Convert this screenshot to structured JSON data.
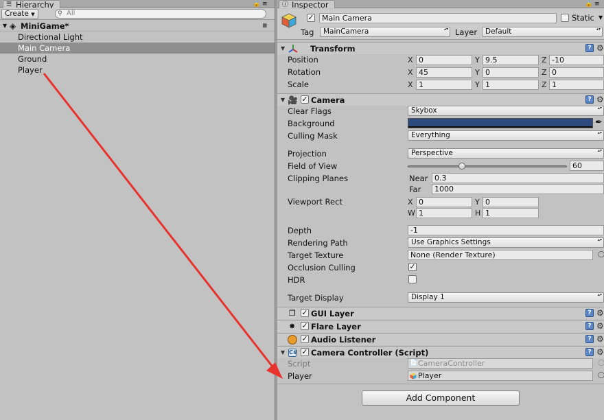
{
  "hierarchy": {
    "tab": "Hierarchy",
    "create_label": "Create",
    "search_placeholder": "All",
    "scene_name": "MiniGame*",
    "items": [
      "Directional Light",
      "Main Camera",
      "Ground",
      "Player"
    ],
    "selected_index": 1
  },
  "inspector": {
    "tab": "Inspector",
    "object_name": "Main Camera",
    "static_label": "Static",
    "tag_label": "Tag",
    "tag_value": "MainCamera",
    "layer_label": "Layer",
    "layer_value": "Default"
  },
  "transform": {
    "title": "Transform",
    "position_label": "Position",
    "rotation_label": "Rotation",
    "scale_label": "Scale",
    "axes": [
      "X",
      "Y",
      "Z"
    ],
    "position": [
      "0",
      "9.5",
      "-10"
    ],
    "rotation": [
      "45",
      "0",
      "0"
    ],
    "scale": [
      "1",
      "1",
      "1"
    ]
  },
  "camera": {
    "title": "Camera",
    "clear_flags_label": "Clear Flags",
    "clear_flags": "Skybox",
    "background_label": "Background",
    "background_color": "#2c4a7c",
    "culling_mask_label": "Culling Mask",
    "culling_mask": "Everything",
    "projection_label": "Projection",
    "projection": "Perspective",
    "fov_label": "Field of View",
    "fov": "60",
    "fov_slider_fraction": 0.337,
    "clipping_label": "Clipping Planes",
    "near_label": "Near",
    "near": "0.3",
    "far_label": "Far",
    "far": "1000",
    "viewport_label": "Viewport Rect",
    "viewport_x_label": "X",
    "viewport_y_label": "Y",
    "viewport_w_label": "W",
    "viewport_h_label": "H",
    "viewport_x": "0",
    "viewport_y": "0",
    "viewport_w": "1",
    "viewport_h": "1",
    "depth_label": "Depth",
    "depth": "-1",
    "rendering_path_label": "Rendering Path",
    "rendering_path": "Use Graphics Settings",
    "target_texture_label": "Target Texture",
    "target_texture": "None (Render Texture)",
    "occlusion_label": "Occlusion Culling",
    "hdr_label": "HDR",
    "target_display_label": "Target Display",
    "target_display": "Display 1"
  },
  "components": {
    "gui_layer": "GUI Layer",
    "flare_layer": "Flare Layer",
    "audio_listener": "Audio Listener",
    "camera_controller": "Camera Controller (Script)",
    "script_label": "Script",
    "script_value": "CameraController",
    "player_label": "Player",
    "player_value": "Player"
  },
  "add_component_label": "Add Component",
  "colors": {
    "annotation_arrow": "#e8322d",
    "selection": "#8e8e8e",
    "help_icon": "#5a86c7"
  }
}
